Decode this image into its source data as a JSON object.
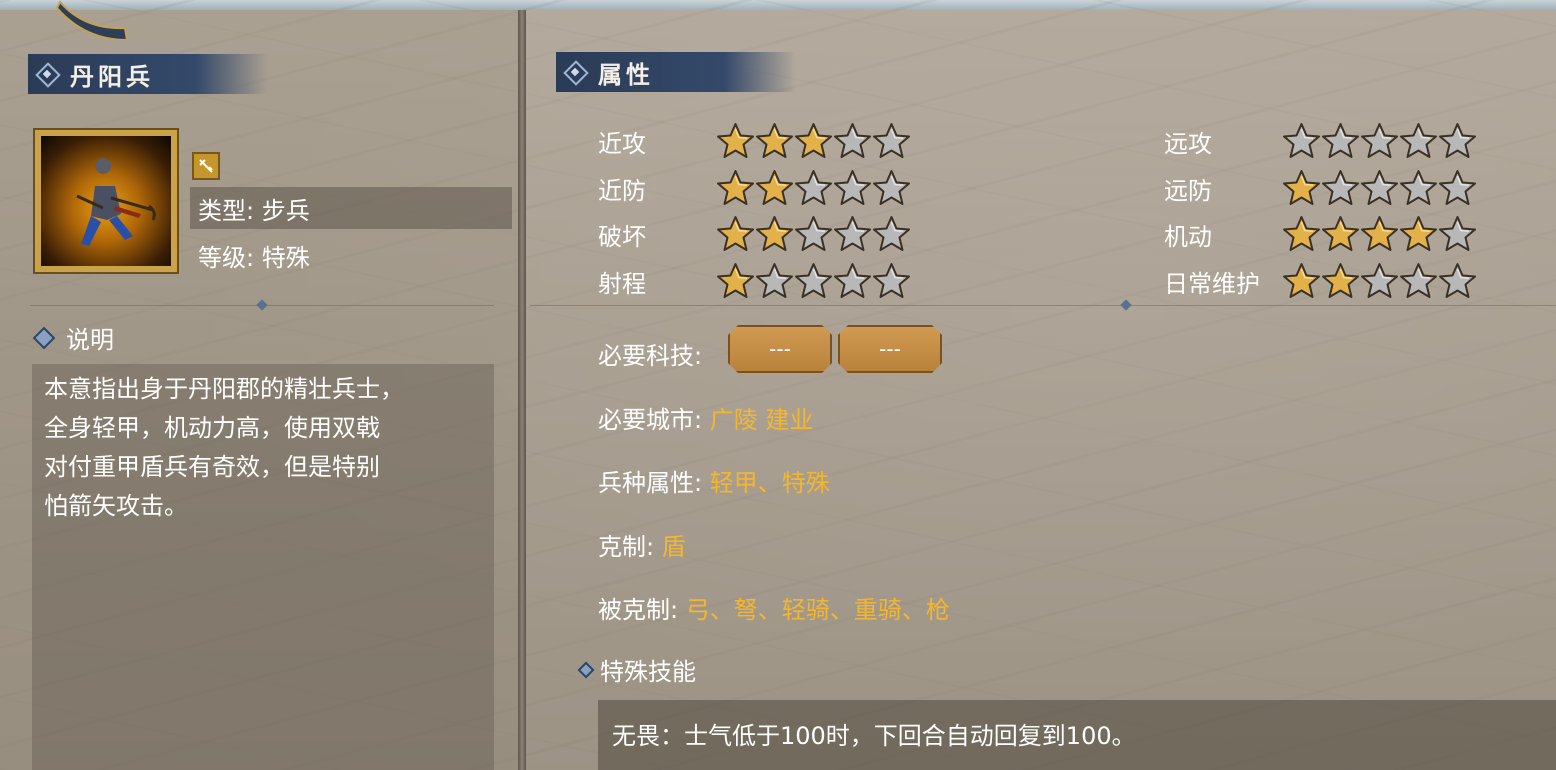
{
  "unit": {
    "name": "丹阳兵",
    "type_label": "类型: 步兵",
    "grade_label": "等级: 特殊"
  },
  "description": {
    "heading": "说明",
    "lines": [
      "本意指出身于丹阳郡的精壮兵士，",
      "全身轻甲，机动力高，使用双戟",
      "对付重甲盾兵有奇效，但是特别",
      "怕箭矢攻击。"
    ]
  },
  "attributes": {
    "heading": "属性",
    "left": [
      {
        "label": "近攻",
        "rating": 3
      },
      {
        "label": "近防",
        "rating": 2
      },
      {
        "label": "破坏",
        "rating": 2
      },
      {
        "label": "射程",
        "rating": 1
      }
    ],
    "right": [
      {
        "label": "远攻",
        "rating": 0
      },
      {
        "label": "远防",
        "rating": 1
      },
      {
        "label": "机动",
        "rating": 4
      },
      {
        "label": "日常维护",
        "rating": 2
      }
    ],
    "max_rating": 5
  },
  "requirements": {
    "tech_label": "必要科技:",
    "tech_slots": [
      "---",
      "---"
    ],
    "city_label": "必要城市:",
    "city_value": "广陵 建业",
    "type_attr_label": "兵种属性:",
    "type_attr_value": "轻甲、特殊",
    "counters_label": "克制:",
    "counters_value": "盾",
    "countered_by_label": "被克制:",
    "countered_by_value": "弓、弩、轻骑、重骑、枪"
  },
  "skills": {
    "heading": "特殊技能",
    "text": "无畏：士气低于100时，下回合自动回复到100。"
  },
  "colors": {
    "accent_gold": "#f5b62e",
    "title_blue": "#2a3b56",
    "star_gold": "#e2b14a",
    "star_gray": "#b8b8b8"
  }
}
